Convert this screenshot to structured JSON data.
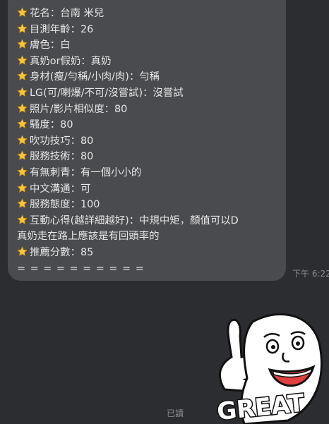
{
  "message": {
    "lines": [
      {
        "star": true,
        "text": "花名：台南 米兒"
      },
      {
        "star": true,
        "text": "目測年齡：26"
      },
      {
        "star": true,
        "text": "膚色：白"
      },
      {
        "star": true,
        "text": "真奶or假奶：真奶"
      },
      {
        "star": true,
        "text": "身材(瘦/勻稱/小肉/肉)：勻稱"
      },
      {
        "star": true,
        "text": "LG(可/喇爆/不可/沒嘗試)：沒嘗試"
      },
      {
        "star": true,
        "text": "照片/影片相似度：80"
      },
      {
        "star": true,
        "text": "騷度：80"
      },
      {
        "star": true,
        "text": "吹功技巧：80"
      },
      {
        "star": true,
        "text": "服務技術：80"
      },
      {
        "star": true,
        "text": "有無刺青：有一個小小的"
      },
      {
        "star": true,
        "text": "中文溝通：可"
      },
      {
        "star": true,
        "text": "服務態度：100"
      },
      {
        "star": true,
        "text": "互動心得(越詳細越好)：中規中矩，顏值可以D"
      },
      {
        "star": false,
        "text": "真奶走在路上應該是有回頭率的"
      },
      {
        "star": true,
        "text": "推薦分數：85"
      }
    ],
    "separator": "= = = = = = = = = =",
    "time": "下午 6:22"
  },
  "sticker": {
    "text": "GREAT",
    "icon": "thumbs-up-face-sticker"
  },
  "read_receipt": "已讀",
  "colors": {
    "background": "#2b2d31",
    "bubble": "#4a4b4f",
    "text": "#e6e6e6",
    "meta": "#8a8c90",
    "star": "#f7c43b"
  }
}
